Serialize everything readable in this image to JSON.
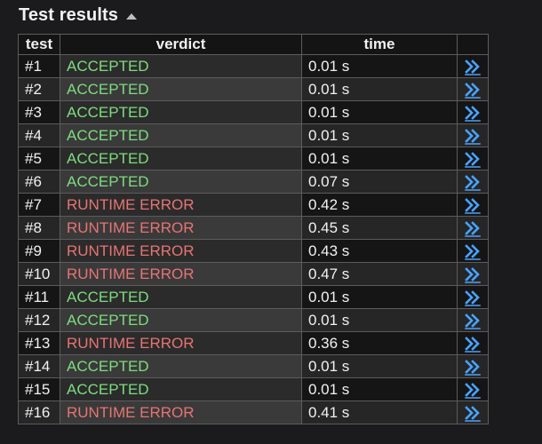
{
  "section": {
    "title": "Test results"
  },
  "table": {
    "headers": {
      "test": "test",
      "verdict": "verdict",
      "time": "time"
    },
    "rows": [
      {
        "num": "#1",
        "verdict": "ACCEPTED",
        "status": "accepted",
        "time": "0.01 s"
      },
      {
        "num": "#2",
        "verdict": "ACCEPTED",
        "status": "accepted",
        "time": "0.01 s"
      },
      {
        "num": "#3",
        "verdict": "ACCEPTED",
        "status": "accepted",
        "time": "0.01 s"
      },
      {
        "num": "#4",
        "verdict": "ACCEPTED",
        "status": "accepted",
        "time": "0.01 s"
      },
      {
        "num": "#5",
        "verdict": "ACCEPTED",
        "status": "accepted",
        "time": "0.01 s"
      },
      {
        "num": "#6",
        "verdict": "ACCEPTED",
        "status": "accepted",
        "time": "0.07 s"
      },
      {
        "num": "#7",
        "verdict": "RUNTIME ERROR",
        "status": "runtime",
        "time": "0.42 s"
      },
      {
        "num": "#8",
        "verdict": "RUNTIME ERROR",
        "status": "runtime",
        "time": "0.45 s"
      },
      {
        "num": "#9",
        "verdict": "RUNTIME ERROR",
        "status": "runtime",
        "time": "0.43 s"
      },
      {
        "num": "#10",
        "verdict": "RUNTIME ERROR",
        "status": "runtime",
        "time": "0.47 s"
      },
      {
        "num": "#11",
        "verdict": "ACCEPTED",
        "status": "accepted",
        "time": "0.01 s"
      },
      {
        "num": "#12",
        "verdict": "ACCEPTED",
        "status": "accepted",
        "time": "0.01 s"
      },
      {
        "num": "#13",
        "verdict": "RUNTIME ERROR",
        "status": "runtime",
        "time": "0.36 s"
      },
      {
        "num": "#14",
        "verdict": "ACCEPTED",
        "status": "accepted",
        "time": "0.01 s"
      },
      {
        "num": "#15",
        "verdict": "ACCEPTED",
        "status": "accepted",
        "time": "0.01 s"
      },
      {
        "num": "#16",
        "verdict": "RUNTIME ERROR",
        "status": "runtime",
        "time": "0.41 s"
      }
    ],
    "row_link_icon": "double-chevron-right-icon"
  },
  "colors": {
    "accepted": "#7fdc7f",
    "runtime_error": "#e87474",
    "link": "#4aa3ff"
  }
}
